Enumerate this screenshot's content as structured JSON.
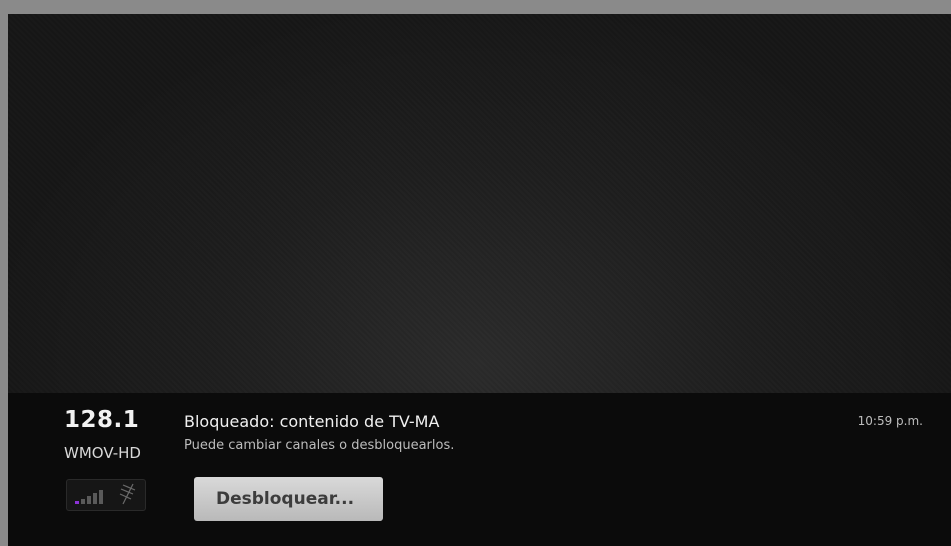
{
  "video": {},
  "channel": {
    "number": "128.1",
    "name": "WMOV-HD",
    "signal_bars_total": 5,
    "signal_bars_lit": 1,
    "signal_color": "#8b32d6"
  },
  "program": {
    "title": "Bloqueado: contenido de TV-MA",
    "subtitle": "Puede cambiar canales o desbloquearlos."
  },
  "clock": {
    "time": "10:59 p.m."
  },
  "actions": {
    "unblock_label": "Desbloquear..."
  },
  "icons": {
    "signal": "signal-strength-icon",
    "antenna": "antenna-icon"
  }
}
